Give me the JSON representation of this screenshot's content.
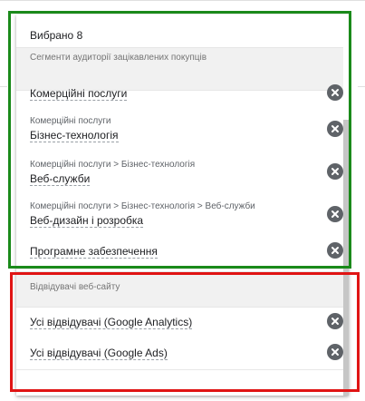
{
  "panel": {
    "selected_count": "Вибрано 8",
    "groups": [
      {
        "header": "Сегменти аудиторії зацікавлених покупців",
        "items": [
          {
            "path": "",
            "label": "Комерційні послуги"
          },
          {
            "path": "Комерційні послуги",
            "label": "Бізнес-технологія"
          },
          {
            "path": "Комерційні послуги > Бізнес-технологія",
            "label": "Веб-служби"
          },
          {
            "path": "Комерційні послуги > Бізнес-технологія > Веб-служби",
            "label": "Веб-дизайн і розробка"
          },
          {
            "path": "",
            "label": "Програмне забезпечення"
          }
        ]
      },
      {
        "header": "Відвідувачі веб-сайту",
        "items": [
          {
            "path": "",
            "label": "Усі відвідувачі (Google Analytics)"
          },
          {
            "path": "",
            "label": "Усі відвідувачі (Google Ads)"
          }
        ]
      }
    ],
    "remove_icon": "close-circle-icon"
  },
  "annotations": {
    "green_frame_color": "#1a8a1a",
    "red_frame_color": "#e01414"
  }
}
